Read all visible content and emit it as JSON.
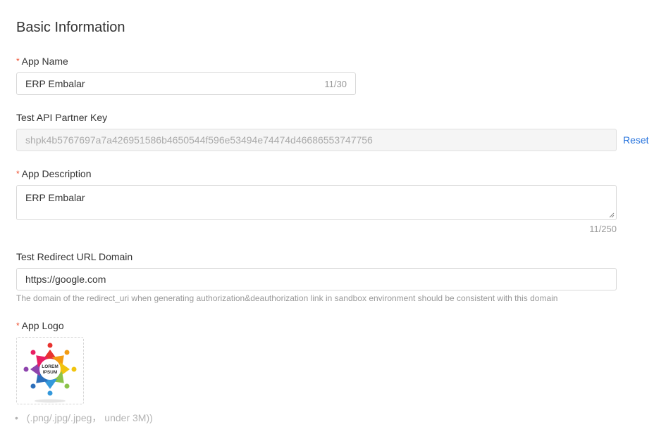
{
  "section_title": "Basic Information",
  "required_mark": "*",
  "app_name": {
    "label": "App Name",
    "value": "ERP Embalar",
    "counter": "11/30"
  },
  "partner_key": {
    "label": "Test API Partner Key",
    "value": "shpk4b5767697a7a426951586b4650544f596e53494e74474d46686553747756",
    "reset_label": "Reset"
  },
  "app_description": {
    "label": "App Description",
    "value": "ERP Embalar",
    "counter": "11/250"
  },
  "redirect_domain": {
    "label": "Test Redirect URL Domain",
    "value": "https://google.com",
    "hint": "The domain of the redirect_uri when generating authorization&deauthorization link in sandbox environment should be consistent with this domain"
  },
  "app_logo": {
    "label": "App Logo",
    "logo_text_line1": "LOREM",
    "logo_text_line2": "IPSUM",
    "format_hint": "(.png/.jpg/.jpeg， under 3M))",
    "bullet": "•"
  },
  "colors": {
    "required": "#ee4d2d",
    "link": "#2673dd",
    "border": "#d9d9d9",
    "disabled_bg": "#f5f5f5"
  }
}
